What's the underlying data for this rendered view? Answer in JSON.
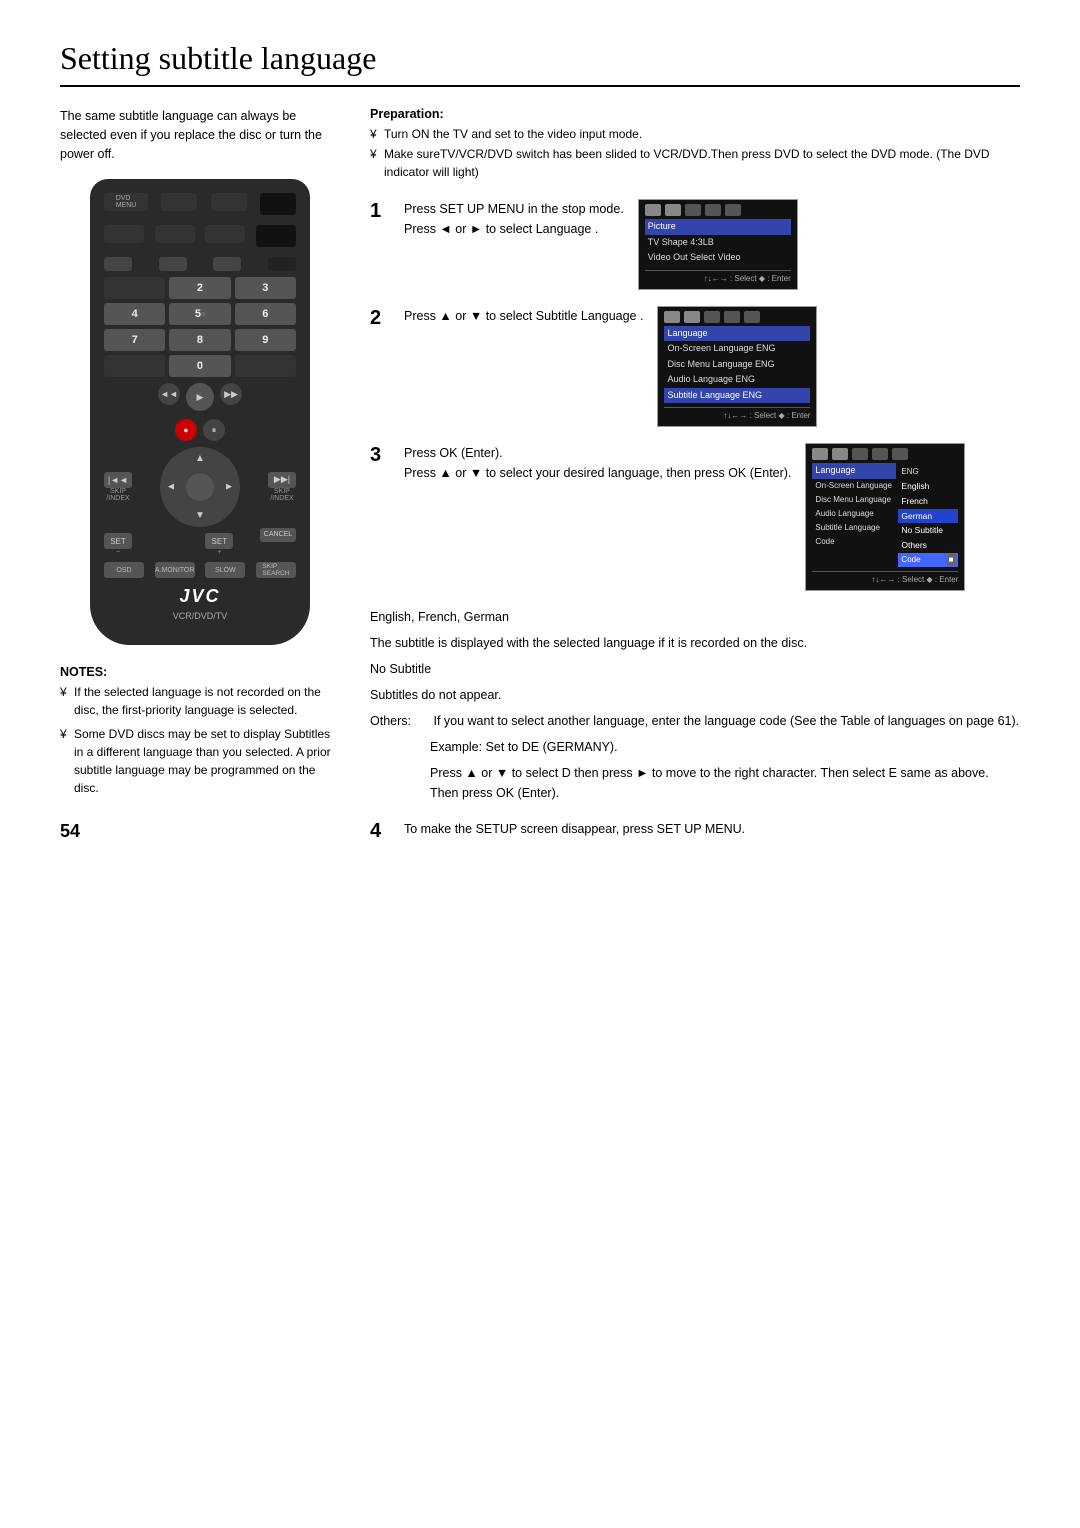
{
  "page": {
    "title": "Setting subtitle language",
    "page_number": "54"
  },
  "left_col": {
    "intro_text": "The same subtitle language can always be selected even if you replace the disc or turn the power off.",
    "remote_label": "VCR/DVD/TV",
    "remote_brand": "JVC"
  },
  "right_col": {
    "prep_title": "Preparation:",
    "prep_items": [
      "Turn ON the TV and set to the video input mode.",
      "Make sureTV/VCR/DVD switch has been slided to VCR/DVD.Then press DVD to select the DVD mode. (The DVD indicator will light)"
    ],
    "steps": [
      {
        "number": "1",
        "text_line1": "Press SET UP MENU in the stop mode.",
        "text_line2": "Press ◄ or ► to select Language .",
        "screen_title": "Picture",
        "screen_items": [
          "Picture",
          "TV Shape 4:3LB",
          "Video Out Select Video"
        ],
        "screen_nav": "↑↓←→ : Select ◆ : Enter"
      },
      {
        "number": "2",
        "text_line1": "Press ▲ or ▼ to select  Subtitle Language .",
        "screen_title": "Language",
        "screen_items": [
          "On-Screen Language ENG",
          "Disc Menu Language ENG",
          "Audio Language  ENG",
          "Subtitle Language  ENG"
        ],
        "screen_highlighted": "Subtitle Language  ENG",
        "screen_nav": "↑↓←→ : Select ◆ : Enter"
      },
      {
        "number": "3",
        "text_line1": "Press OK (Enter).",
        "text_line2": "Press ▲ or ▼ to select your desired language, then press OK (Enter).",
        "screen_title": "Language",
        "screen_items_left": [
          "On-Screen Language",
          "Disc Menu Language",
          "Audio Language",
          "Subtitle Language"
        ],
        "screen_items_right": [
          "ENG",
          "ENG",
          "ENG",
          "ENG"
        ],
        "sub_menu": [
          "English",
          "French",
          "German",
          "No Subtitle",
          "Others",
          "Code"
        ],
        "screen_nav": "↑↓←→ : Select ◆ : Enter"
      },
      {
        "number": "4",
        "text": "To make the SETUP screen disappear, press SET UP MENU."
      }
    ],
    "info": {
      "lang_list": "English, French, German",
      "subtitle_note_title": "The subtitle is displayed with the selected language if it is recorded on the disc.",
      "no_subtitle_title": "No Subtitle",
      "no_subtitle_text": "Subtitles do not appear.",
      "others_label": "Others:",
      "others_text": "If you want to select another language, enter the language code (See the Table of languages on page 61).",
      "example_label": "Example:",
      "example_text": "Set to DE (GERMANY).",
      "example_detail": "Press ▲ or ▼ to select D then press ► to move to the right character. Then select E  same as above.  Then press OK (Enter)."
    }
  },
  "notes": {
    "title": "NOTES:",
    "items": [
      "If the selected language is not recorded on the disc, the first-priority language is selected.",
      "Some DVD discs may be set to display Subtitles in a different language than you selected. A prior subtitle language may be programmed on the disc."
    ]
  }
}
